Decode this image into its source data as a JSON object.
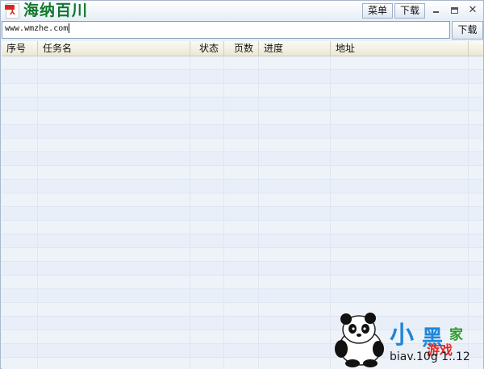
{
  "titlebar": {
    "app_title": "海纳百川",
    "menu_label": "菜单",
    "download_label": "下载",
    "minimize_label": "",
    "maximize_label": "",
    "close_label": "✕"
  },
  "address": {
    "value": "www.wmzhe.com",
    "download_label": "下载"
  },
  "table": {
    "columns": [
      "序号",
      "任务名",
      "状态",
      "页数",
      "进度",
      "地址"
    ],
    "rows": []
  },
  "watermark": {
    "text_small": "小",
    "text_mid": "黑",
    "text_green": "家",
    "text_red": "游戏",
    "url": "biav.10g 1..12"
  },
  "colors": {
    "title_green": "#10782c",
    "header_bg": "#ece8d6",
    "row_alt": "#e8eff8"
  }
}
